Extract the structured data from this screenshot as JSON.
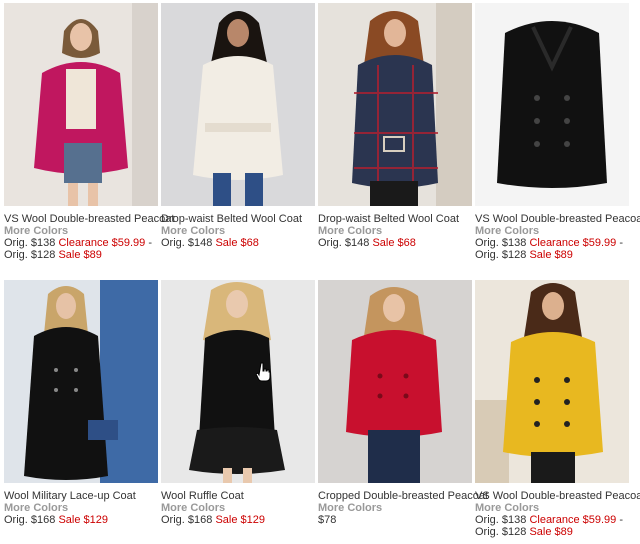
{
  "products": [
    {
      "title": "VS Wool Double-breasted Peacoat",
      "more": "More Colors",
      "orig_label": "Orig. $138",
      "clearance_label": "Clearance",
      "clearance_price": "$59.99",
      "dash": "- Orig.",
      "orig2": "$128",
      "sale_label": "Sale",
      "sale_price": "$89"
    },
    {
      "title": "Drop-waist Belted Wool Coat",
      "more": "More Colors",
      "orig_label": "Orig. $148",
      "sale_label": "Sale",
      "sale_price": "$68"
    },
    {
      "title": "Drop-waist Belted Wool Coat",
      "more": "More Colors",
      "orig_label": "Orig. $148",
      "sale_label": "Sale",
      "sale_price": "$68"
    },
    {
      "title": "VS Wool Double-breasted Peacoat",
      "more": "More Colors",
      "orig_label": "Orig. $138",
      "clearance_label": "Clearance",
      "clearance_price": "$59.99",
      "dash": "- Orig.",
      "orig2": "$128",
      "sale_label": "Sale",
      "sale_price": "$89"
    },
    {
      "title": "Wool Military Lace-up Coat",
      "more": "More Colors",
      "orig_label": "Orig. $168",
      "sale_label": "Sale",
      "sale_price": "$129"
    },
    {
      "title": "Wool Ruffle Coat",
      "more": "More Colors",
      "orig_label": "Orig. $168",
      "sale_label": "Sale",
      "sale_price": "$129"
    },
    {
      "title": "Cropped Double-breasted Peacoat",
      "more": "More Colors",
      "price": "$78"
    },
    {
      "title": "VS Wool Double-breasted Peacoat",
      "more": "More Colors",
      "orig_label": "Orig. $138",
      "clearance_label": "Clearance",
      "clearance_price": "$59.99",
      "dash": "- Orig.",
      "orig2": "$128",
      "sale_label": "Sale",
      "sale_price": "$89"
    }
  ],
  "colors": {
    "sale_red": "#cc0000",
    "more_colors_gray": "#999999",
    "coat_magenta": "#c0175f",
    "coat_cream": "#f2ede4",
    "coat_plaid": "#2b3550",
    "coat_black": "#111111",
    "coat_red": "#c8102e",
    "coat_yellow": "#e8b820"
  }
}
